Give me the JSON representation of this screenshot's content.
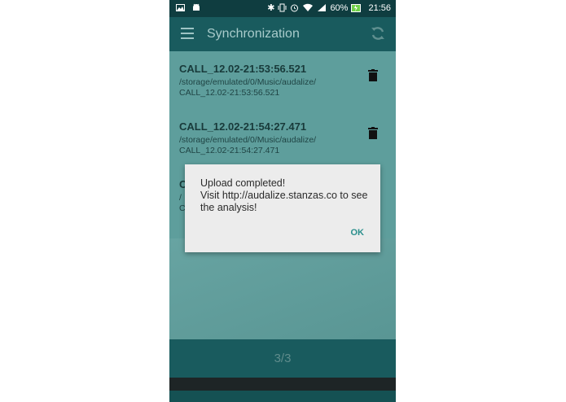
{
  "status_bar": {
    "battery": "60%",
    "time": "21:56",
    "icons": [
      "gallery-icon",
      "android-icon",
      "bluetooth-icon",
      "vibrate-icon",
      "alarm-icon",
      "wifi-icon",
      "signal-icon",
      "battery-charging-icon"
    ]
  },
  "app_bar": {
    "title": "Synchronization",
    "menu_icon": "hamburger-menu-icon",
    "sync_icon": "sync-icon"
  },
  "recordings": [
    {
      "name": "CALL_12.02-21:53:56.521",
      "path_line1": "/storage/emulated/0/Music/audalize/",
      "path_line2": "CALL_12.02-21:53:56.521"
    },
    {
      "name": "CALL_12.02-21:54:27.471",
      "path_line1": "/storage/emulated/0/Music/audalize/",
      "path_line2": "CALL_12.02-21:54:27.471"
    },
    {
      "name": "C",
      "path_line1": "/",
      "path_line2": "C"
    }
  ],
  "pager": "3/3",
  "dialog": {
    "line1": "Upload completed!",
    "line2": "Visit http://audalize.stanzas.co to see the analysis!",
    "ok_label": "OK"
  },
  "colors": {
    "status_bar": "#0f3d40",
    "app_bar": "#195b5e",
    "accent": "#2a8f8c"
  }
}
